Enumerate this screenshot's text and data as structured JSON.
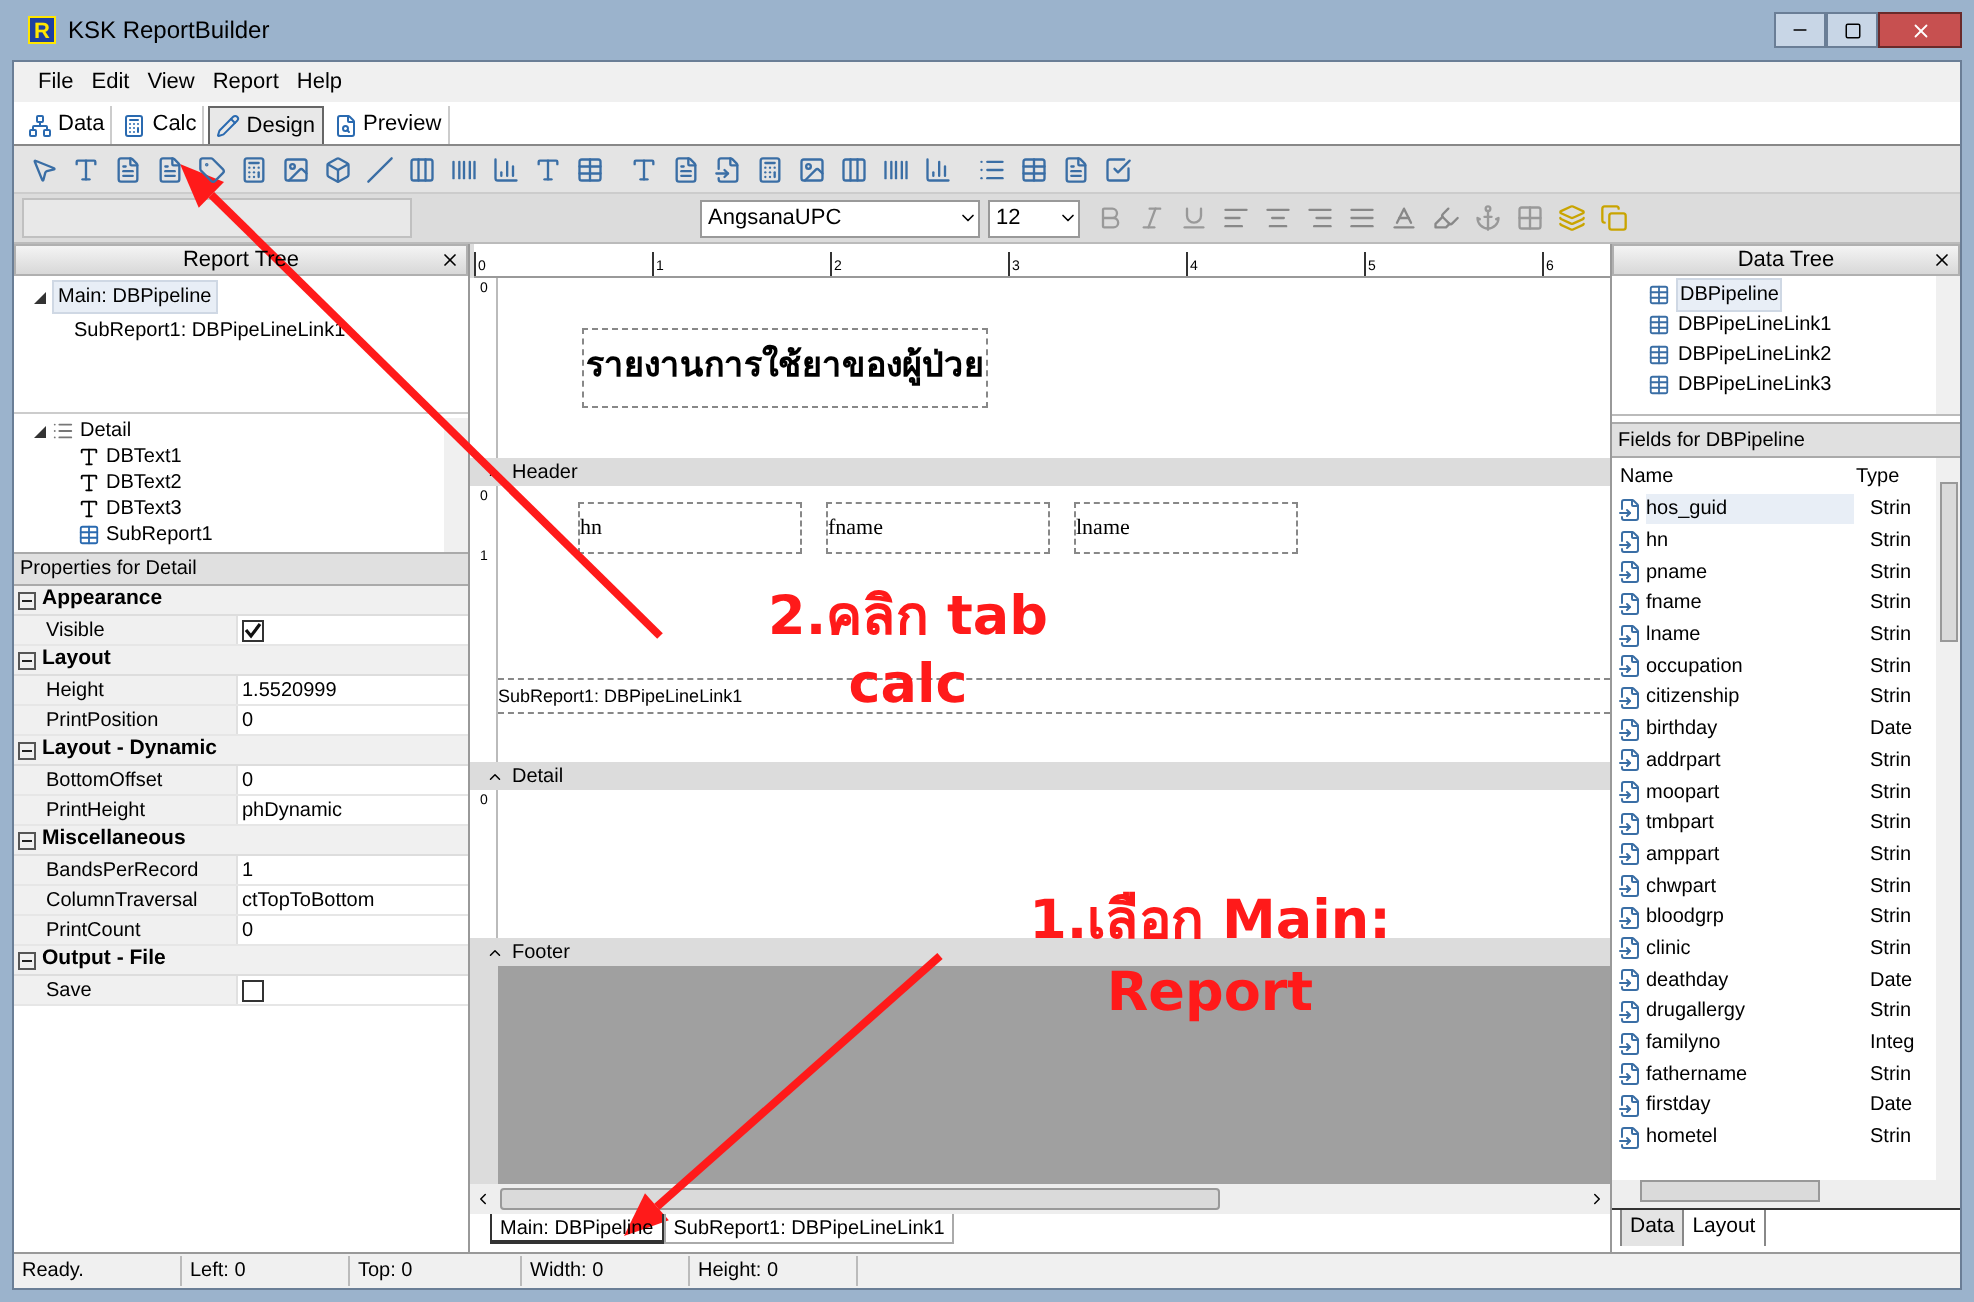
{
  "window": {
    "title": "KSK ReportBuilder",
    "icon_letter": "R"
  },
  "menu": [
    "File",
    "Edit",
    "View",
    "Report",
    "Help"
  ],
  "tabs": [
    {
      "label": "Data",
      "selected": false,
      "kind": "data"
    },
    {
      "label": "Calc",
      "selected": false,
      "kind": "calc"
    },
    {
      "label": "Design",
      "selected": true,
      "kind": "design"
    },
    {
      "label": "Preview",
      "selected": false,
      "kind": "preview"
    }
  ],
  "format_toolbar": {
    "font": "AngsanaUPC",
    "size": "12"
  },
  "report_tree": {
    "title": "Report Tree",
    "items": [
      {
        "label": "Main: DBPipeline",
        "selected": true,
        "expanded": true,
        "children": [
          {
            "label": "SubReport1: DBPipeLineLink1",
            "selected": false
          }
        ]
      }
    ]
  },
  "component_tree": {
    "items": [
      {
        "label": "Detail",
        "kind": "band",
        "expanded": true,
        "children": [
          {
            "label": "DBText1",
            "kind": "text"
          },
          {
            "label": "DBText2",
            "kind": "text"
          },
          {
            "label": "DBText3",
            "kind": "text"
          },
          {
            "label": "SubReport1",
            "kind": "subreport"
          }
        ]
      }
    ]
  },
  "properties": {
    "title": "Properties for Detail",
    "groups": [
      {
        "name": "Appearance",
        "expanded": true,
        "rows": [
          {
            "name": "Visible",
            "kind": "checkbox",
            "checked": true
          }
        ]
      },
      {
        "name": "Layout",
        "expanded": true,
        "rows": [
          {
            "name": "Height",
            "kind": "text",
            "value": "1.5520999"
          },
          {
            "name": "PrintPosition",
            "kind": "text",
            "value": "0"
          }
        ]
      },
      {
        "name": "Layout - Dynamic",
        "expanded": true,
        "rows": [
          {
            "name": "BottomOffset",
            "kind": "text",
            "value": "0"
          },
          {
            "name": "PrintHeight",
            "kind": "text",
            "value": "phDynamic"
          }
        ]
      },
      {
        "name": "Miscellaneous",
        "expanded": true,
        "rows": [
          {
            "name": "BandsPerRecord",
            "kind": "text",
            "value": "1"
          },
          {
            "name": "ColumnTraversal",
            "kind": "text",
            "value": "ctTopToBottom"
          },
          {
            "name": "PrintCount",
            "kind": "text",
            "value": "0"
          }
        ]
      },
      {
        "name": "Output - File",
        "expanded": true,
        "rows": [
          {
            "name": "Save",
            "kind": "checkbox",
            "checked": false
          }
        ]
      }
    ]
  },
  "designer": {
    "ruler": [
      "0",
      "1",
      "2",
      "3",
      "4",
      "5",
      "6"
    ],
    "title_band": {
      "ruler": [
        "0"
      ],
      "title": "รายงานการใช้ยาของผู้ป่วย"
    },
    "header_band": {
      "label": "Header",
      "ruler": [
        "0",
        "1"
      ],
      "fields": [
        "hn",
        "fname",
        "lname"
      ],
      "subreport": "SubReport1: DBPipeLineLink1"
    },
    "detail_band": {
      "label": "Detail",
      "ruler": [
        "0"
      ]
    },
    "footer_band": {
      "label": "Footer"
    },
    "tabs": [
      {
        "label": "Main: DBPipeline",
        "selected": true
      },
      {
        "label": "SubReport1: DBPipeLineLink1",
        "selected": false
      }
    ]
  },
  "data_tree": {
    "title": "Data Tree",
    "items": [
      {
        "label": "DBPipeline",
        "selected": true
      },
      {
        "label": "DBPipeLineLink1",
        "selected": false
      },
      {
        "label": "DBPipeLineLink2",
        "selected": false
      },
      {
        "label": "DBPipeLineLink3",
        "selected": false
      }
    ]
  },
  "fields": {
    "title": "Fields for DBPipeline",
    "columns": [
      "Name",
      "Type"
    ],
    "rows": [
      {
        "name": "hos_guid",
        "type": "Strin",
        "selected": true
      },
      {
        "name": "hn",
        "type": "Strin",
        "selected": false
      },
      {
        "name": "pname",
        "type": "Strin",
        "selected": false
      },
      {
        "name": "fname",
        "type": "Strin",
        "selected": false
      },
      {
        "name": "lname",
        "type": "Strin",
        "selected": false
      },
      {
        "name": "occupation",
        "type": "Strin",
        "selected": false
      },
      {
        "name": "citizenship",
        "type": "Strin",
        "selected": false
      },
      {
        "name": "birthday",
        "type": "Date",
        "selected": false
      },
      {
        "name": "addrpart",
        "type": "Strin",
        "selected": false
      },
      {
        "name": "moopart",
        "type": "Strin",
        "selected": false
      },
      {
        "name": "tmbpart",
        "type": "Strin",
        "selected": false
      },
      {
        "name": "amppart",
        "type": "Strin",
        "selected": false
      },
      {
        "name": "chwpart",
        "type": "Strin",
        "selected": false
      },
      {
        "name": "bloodgrp",
        "type": "Strin",
        "selected": false
      },
      {
        "name": "clinic",
        "type": "Strin",
        "selected": false
      },
      {
        "name": "deathday",
        "type": "Date",
        "selected": false
      },
      {
        "name": "drugallergy",
        "type": "Strin",
        "selected": false
      },
      {
        "name": "familyno",
        "type": "Integ",
        "selected": false
      },
      {
        "name": "fathername",
        "type": "Strin",
        "selected": false
      },
      {
        "name": "firstday",
        "type": "Date",
        "selected": false
      },
      {
        "name": "hometel",
        "type": "Strin",
        "selected": false
      }
    ]
  },
  "right_tabs": [
    {
      "label": "Data",
      "selected": true
    },
    {
      "label": "Layout",
      "selected": false
    }
  ],
  "status_bar": [
    "Ready.",
    "Left: 0",
    "Top: 0",
    "Width: 0",
    "Height: 0"
  ],
  "annotations": [
    {
      "kind": "calc",
      "text": "2.คลิก tab calc"
    },
    {
      "kind": "main",
      "text": "1.เลือก Main: Report"
    }
  ]
}
